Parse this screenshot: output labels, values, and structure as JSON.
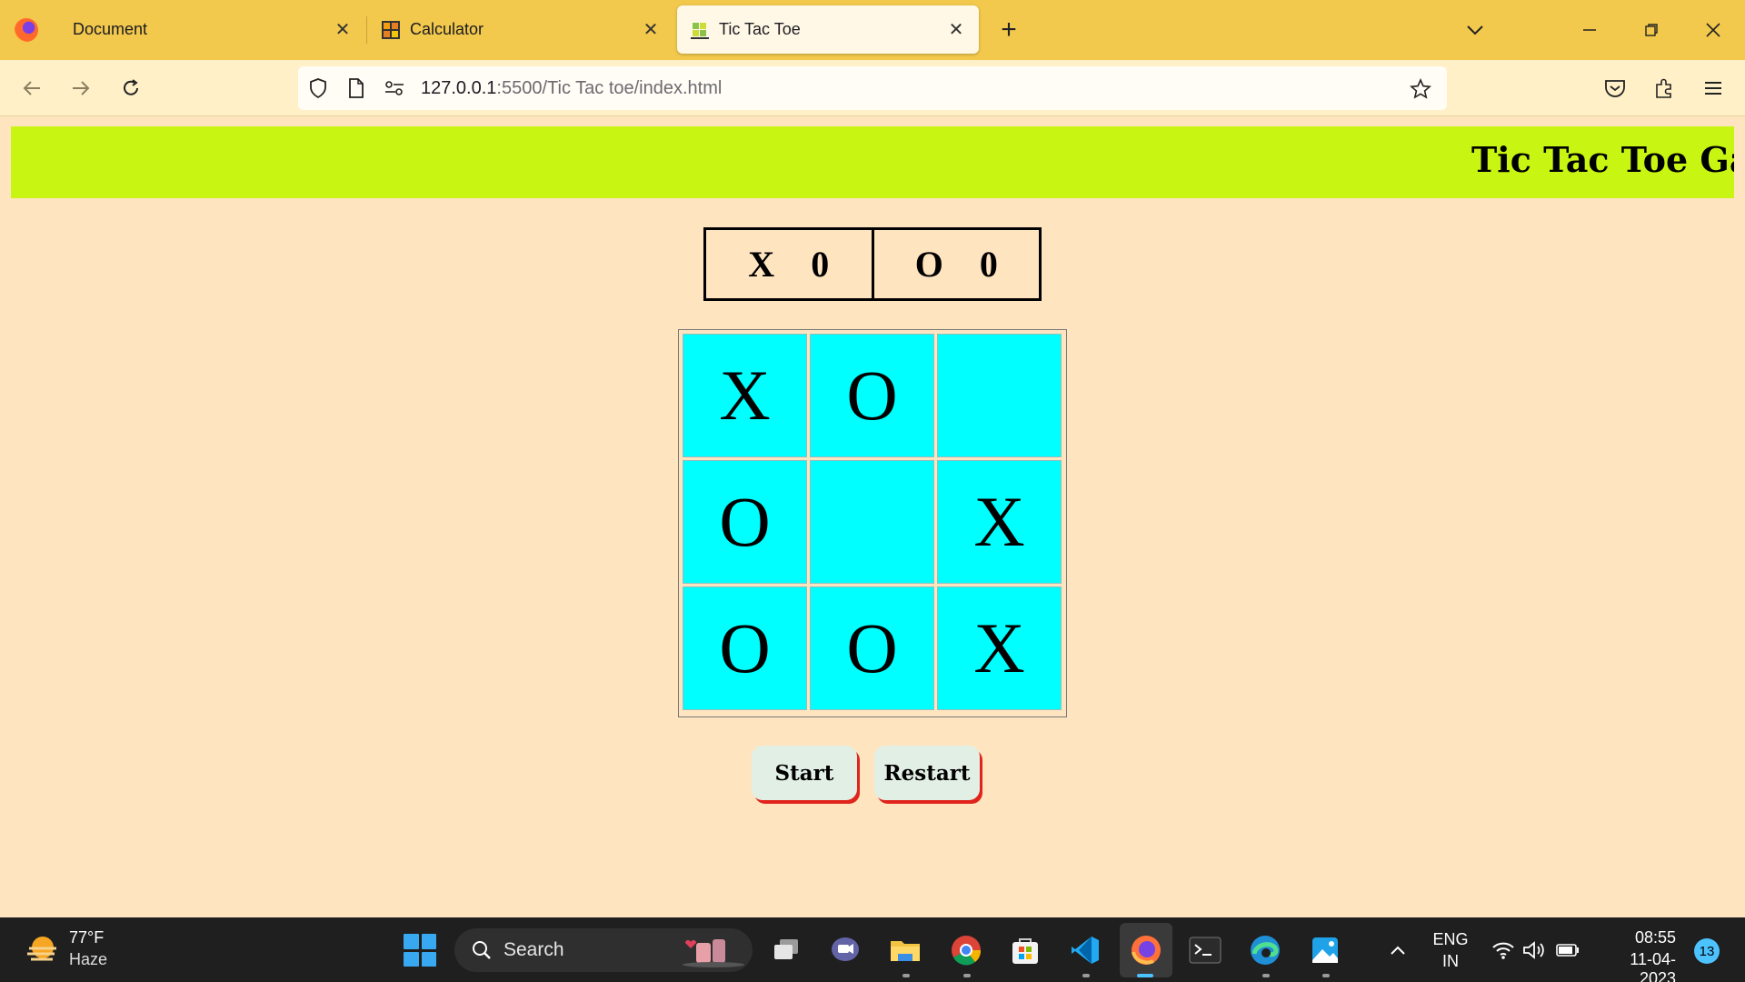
{
  "browser": {
    "tabs": [
      {
        "title": "Document",
        "favicon": "firefox-icon",
        "active": false
      },
      {
        "title": "Calculator",
        "favicon": "calculator-icon",
        "active": false
      },
      {
        "title": "Tic Tac Toe",
        "favicon": "tictactoe-icon",
        "active": true
      }
    ],
    "url_host": "127.0.0.1",
    "url_rest": ":5500/Tic Tac toe/index.html",
    "theme_color": "#f2c94c"
  },
  "page": {
    "banner_title": "Tic Tac Toe Game",
    "score": {
      "x_label": "X",
      "x_value": "0",
      "o_label": "O",
      "o_value": "0"
    },
    "board": [
      "X",
      "O",
      "",
      "O",
      "",
      "X",
      "O",
      "O",
      "X"
    ],
    "start_label": "Start",
    "restart_label": "Restart",
    "colors": {
      "banner": "#c8f511",
      "cell": "#00ffff",
      "background": "#ffe4c0",
      "button_shadow": "#e0241b"
    }
  },
  "taskbar": {
    "weather_temp": "77°F",
    "weather_cond": "Haze",
    "search_placeholder": "Search",
    "lang_top": "ENG",
    "lang_bottom": "IN",
    "time": "08:55",
    "date": "11-04-2023",
    "notification_count": "13"
  }
}
